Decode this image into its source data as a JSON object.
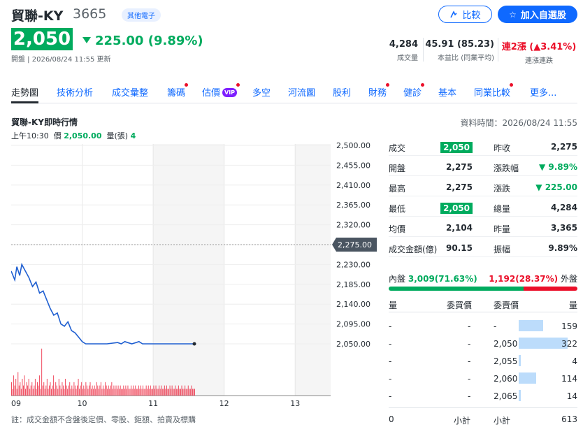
{
  "header": {
    "name": "貿聯-KY",
    "code": "3665",
    "tag": "其他電子",
    "compare_label": "比較",
    "watchlist_label": "加入自選股"
  },
  "price": {
    "last": "2,050",
    "change": "225.00 (9.89%)",
    "updated": "開盤 | 2026/08/24 11:55 更新"
  },
  "stats": [
    {
      "value": "4,284",
      "label": "成交量"
    },
    {
      "value": "45.91 (85.23)",
      "label": "本益比 (同業平均)"
    },
    {
      "value": "連2漲 (▲3.41%)",
      "label": "連漲連跌"
    }
  ],
  "tabs": [
    {
      "label": "走勢圖",
      "active": true,
      "dot": false
    },
    {
      "label": "技術分析",
      "dot": false
    },
    {
      "label": "成交彙整",
      "dot": false
    },
    {
      "label": "籌碼",
      "dot": true
    },
    {
      "label": "估價",
      "dot": true,
      "vip": "VIP"
    },
    {
      "label": "多空",
      "dot": false
    },
    {
      "label": "河流圖",
      "dot": false
    },
    {
      "label": "股利",
      "dot": false
    },
    {
      "label": "財務",
      "dot": true
    },
    {
      "label": "健診",
      "dot": true
    },
    {
      "label": "基本",
      "dot": false
    },
    {
      "label": "同業比較",
      "dot": true
    },
    {
      "label": "更多...",
      "dot": false
    }
  ],
  "section": {
    "title": "貿聯-KY即時行情",
    "data_time": "資料時間：2026/08/24 11:55",
    "quote_time": "上午10:30",
    "quote_price_label": "價",
    "quote_price": "2,050.00",
    "quote_vol_label": "量(張)",
    "quote_vol": "4"
  },
  "chart_data": {
    "type": "line",
    "y_ticks": [
      "2,500.00",
      "2,455.00",
      "2,410.00",
      "2,365.00",
      "2,320.00",
      "2,275.00",
      "2,230.00",
      "2,185.00",
      "2,140.00",
      "2,095.00",
      "2,050.00"
    ],
    "x_ticks": [
      "09",
      "10",
      "11",
      "12",
      "13"
    ],
    "ylim": [
      2050,
      2500
    ],
    "ref_price": 2275,
    "ref_label": "2,275.00",
    "line": [
      [
        9.0,
        2215
      ],
      [
        9.05,
        2195
      ],
      [
        9.08,
        2225
      ],
      [
        9.12,
        2205
      ],
      [
        9.15,
        2230
      ],
      [
        9.2,
        2215
      ],
      [
        9.25,
        2200
      ],
      [
        9.3,
        2180
      ],
      [
        9.35,
        2190
      ],
      [
        9.4,
        2165
      ],
      [
        9.45,
        2170
      ],
      [
        9.5,
        2150
      ],
      [
        9.55,
        2130
      ],
      [
        9.6,
        2115
      ],
      [
        9.65,
        2120
      ],
      [
        9.7,
        2095
      ],
      [
        9.75,
        2090
      ],
      [
        9.8,
        2100
      ],
      [
        9.85,
        2080
      ],
      [
        9.9,
        2075
      ],
      [
        9.95,
        2065
      ],
      [
        10.0,
        2055
      ],
      [
        10.05,
        2050
      ],
      [
        10.2,
        2050
      ],
      [
        10.35,
        2050
      ],
      [
        10.5,
        2053
      ],
      [
        10.55,
        2050
      ],
      [
        10.6,
        2055
      ],
      [
        10.7,
        2050
      ],
      [
        10.8,
        2055
      ],
      [
        10.85,
        2050
      ],
      [
        10.95,
        2050
      ],
      [
        11.1,
        2050
      ],
      [
        11.3,
        2050
      ],
      [
        11.5,
        2050
      ],
      [
        11.58,
        2050
      ]
    ],
    "volume": [
      4,
      2,
      6,
      3,
      5,
      2,
      7,
      3,
      4,
      2,
      5,
      3,
      6,
      2,
      4,
      3,
      5,
      2,
      3,
      4,
      2,
      3,
      5,
      2,
      4,
      3,
      6,
      2,
      14,
      3,
      4,
      2,
      3,
      5,
      2,
      3,
      4,
      2,
      3,
      6,
      2,
      4,
      3,
      2,
      5,
      3,
      2,
      4,
      3,
      2,
      5,
      3,
      2,
      3,
      4,
      2,
      3,
      2,
      4,
      3,
      2,
      3,
      5,
      2,
      3,
      4,
      2,
      3,
      2,
      4,
      3,
      2,
      3,
      4,
      2,
      3,
      2,
      3,
      2,
      4,
      3,
      2,
      3,
      4,
      2,
      3,
      2,
      4,
      3,
      2,
      3,
      2,
      3,
      4,
      2,
      3,
      2,
      3,
      2,
      3,
      2,
      3,
      2,
      2,
      3,
      2,
      3,
      2,
      3,
      2,
      2,
      3,
      2,
      3,
      2,
      3,
      2,
      2,
      3,
      2,
      3,
      2,
      3,
      2,
      2,
      3,
      2,
      3,
      2,
      3,
      2,
      2,
      3,
      2,
      3,
      2,
      2,
      3,
      2,
      3,
      2,
      2,
      3,
      2,
      3,
      2,
      2,
      3,
      2,
      3,
      2,
      2,
      3,
      2,
      2,
      3,
      2,
      2,
      3,
      2,
      2,
      3,
      2,
      2,
      3,
      2,
      2,
      3,
      2,
      2,
      2
    ],
    "volume_max": 15
  },
  "info": {
    "left": [
      {
        "label": "成交",
        "value": "2,050",
        "chip": true
      },
      {
        "label": "開盤",
        "value": "2,275"
      },
      {
        "label": "最高",
        "value": "2,275"
      },
      {
        "label": "最低",
        "value": "2,050",
        "chip": true
      },
      {
        "label": "均價",
        "value": "2,104"
      },
      {
        "label": "成交金額(億)",
        "value": "90.15"
      }
    ],
    "right": [
      {
        "label": "昨收",
        "value": "2,275"
      },
      {
        "label": "漲跌幅",
        "value": "▼ 9.89%",
        "green": true
      },
      {
        "label": "漲跌",
        "value": "▼ 225.00",
        "green": true
      },
      {
        "label": "總量",
        "value": "4,284"
      },
      {
        "label": "昨量",
        "value": "3,365"
      },
      {
        "label": "振幅",
        "value": "9.89%"
      }
    ]
  },
  "ratio": {
    "in_label": "內盤",
    "in_value": "3,009(71.63%)",
    "out_value": "1,192(28.37%)",
    "out_label": "外盤",
    "in_pct": 71.63,
    "colors": {
      "in": "#00ab5e",
      "out": "#eb0f29"
    }
  },
  "orderbook": {
    "headers": [
      "量",
      "委買價",
      "委賣價",
      "量"
    ],
    "rows": [
      {
        "bid_vol": "-",
        "bid": "-",
        "ask": "-",
        "ask_vol": "159",
        "fill": 0.13
      },
      {
        "bid_vol": "-",
        "bid": "-",
        "ask": "2,050",
        "ask_vol": "322",
        "fill": 0.26
      },
      {
        "bid_vol": "-",
        "bid": "-",
        "ask": "2,055",
        "ask_vol": "4",
        "fill": 0.0
      },
      {
        "bid_vol": "-",
        "bid": "-",
        "ask": "2,060",
        "ask_vol": "114",
        "fill": 0.093
      },
      {
        "bid_vol": "-",
        "bid": "-",
        "ask": "2,065",
        "ask_vol": "14",
        "fill": 0.011
      }
    ],
    "footer": {
      "bid_total": "0",
      "bid_label": "小計",
      "ask_label": "小計",
      "ask_total": "613"
    }
  },
  "footnote": "註：成交金額不含盤後定價、零股、鉅額、拍賣及標購"
}
